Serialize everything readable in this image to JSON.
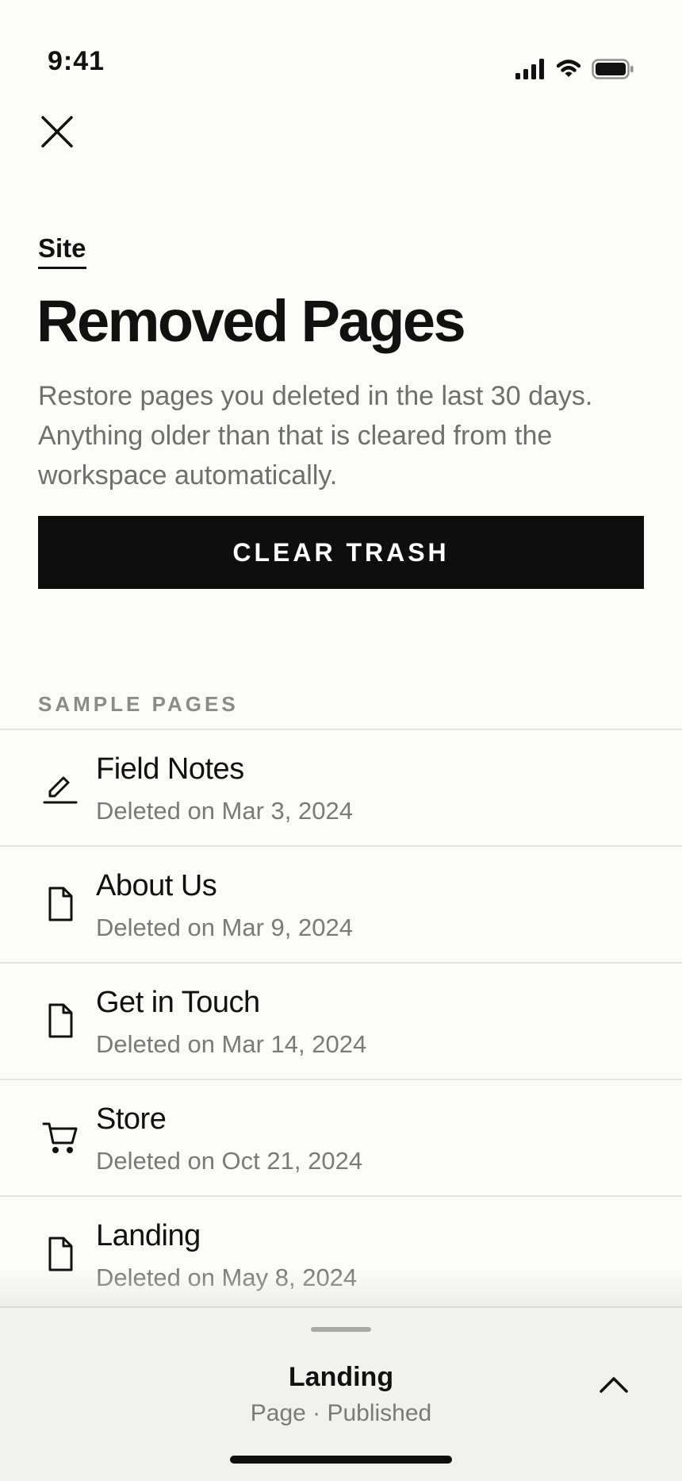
{
  "status_bar": {
    "time": "9:41",
    "icons": [
      "signal-icon",
      "wifi-icon",
      "battery-icon"
    ]
  },
  "header": {
    "close_icon": "close-icon",
    "breadcrumb": "Site",
    "title": "Removed Pages",
    "description": "Restore pages you deleted in the last 30 days. Anything older than that is cleared from the workspace automatically."
  },
  "actions": {
    "clear_trash_label": "CLEAR TRASH"
  },
  "section": {
    "label": "SAMPLE PAGES"
  },
  "pages": [
    {
      "title": "Field Notes",
      "subtitle": "Deleted on Mar 3, 2024",
      "icon": "edit-icon"
    },
    {
      "title": "About Us",
      "subtitle": "Deleted on Mar 9, 2024",
      "icon": "document-icon"
    },
    {
      "title": "Get in Touch",
      "subtitle": "Deleted on Mar 14, 2024",
      "icon": "document-icon"
    },
    {
      "title": "Store",
      "subtitle": "Deleted on Oct 21, 2024",
      "icon": "cart-icon"
    },
    {
      "title": "Landing",
      "subtitle": "Deleted on May 8, 2024",
      "icon": "document-icon"
    }
  ],
  "bottom_sheet": {
    "title": "Landing",
    "subtitle": "Page · Published",
    "expand_icon": "chevron-up-icon"
  },
  "colors": {
    "background": "#fbfbf8",
    "primary_button": "#0e0e0e",
    "text": "#111111",
    "muted_text": "#7a7a77",
    "divider": "#e4e4e0",
    "sheet_background": "#f1f1ee"
  }
}
